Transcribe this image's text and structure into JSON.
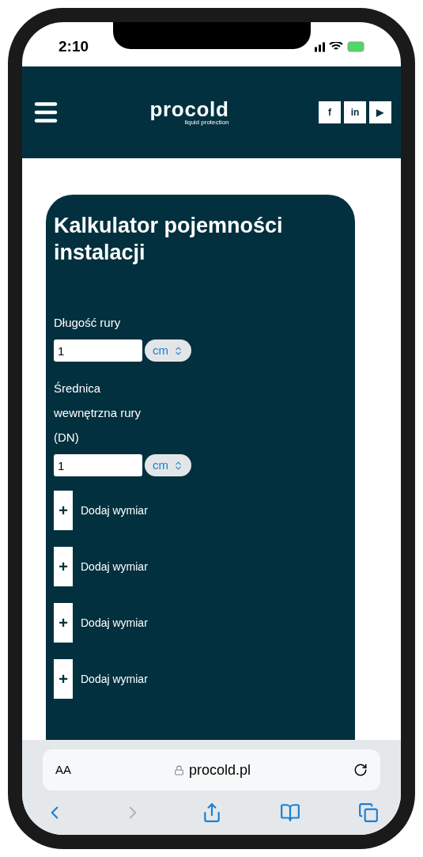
{
  "status_bar": {
    "time": "2:10"
  },
  "header": {
    "logo": "procold",
    "logo_tagline": "liquid protection",
    "social": [
      {
        "label": "f"
      },
      {
        "label": "in"
      },
      {
        "label": "▶"
      }
    ]
  },
  "calculator": {
    "title": "Kalkulator pojemności instalacji",
    "fields": [
      {
        "label": "Długość rury",
        "value": "1",
        "unit": "cm"
      },
      {
        "label": "Średnica wewnętrzna rury (DN)",
        "value": "1",
        "unit": "cm"
      }
    ],
    "add_buttons": [
      {
        "icon": "+",
        "label": "Dodaj wymiar"
      },
      {
        "icon": "+",
        "label": "Dodaj wymiar"
      },
      {
        "icon": "+",
        "label": "Dodaj wymiar"
      },
      {
        "icon": "+",
        "label": "Dodaj wymiar"
      }
    ]
  },
  "browser": {
    "text_size": "AA",
    "url": "procold.pl",
    "toolbar": [
      {
        "kind": "back",
        "disabled": false
      },
      {
        "kind": "forward",
        "disabled": true
      },
      {
        "kind": "share",
        "disabled": false
      },
      {
        "kind": "bookmarks",
        "disabled": false
      },
      {
        "kind": "tabs",
        "disabled": false
      }
    ]
  }
}
